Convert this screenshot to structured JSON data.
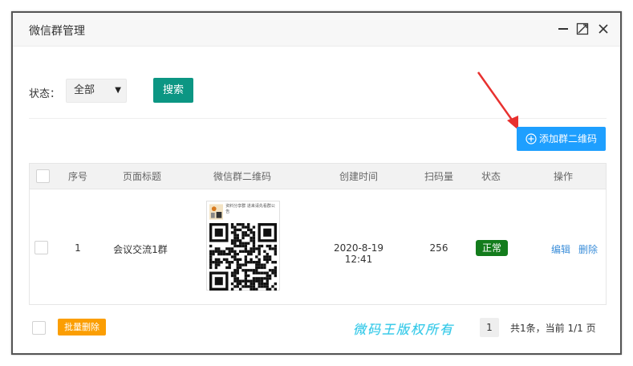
{
  "window": {
    "title": "微信群管理",
    "controls": [
      "minimize-icon",
      "maximize-icon",
      "close-icon"
    ]
  },
  "filter": {
    "status_label": "状态：",
    "status_value": "全部",
    "search_label": "搜索"
  },
  "toolbar": {
    "add_label": "添加群二维码",
    "add_icon": "plus-circle-icon"
  },
  "table": {
    "headers": [
      "序号",
      "页面标题",
      "微信群二维码",
      "创建时间",
      "扫码量",
      "状态",
      "操作"
    ],
    "rows": [
      {
        "index": "1",
        "title": "会议交流1群",
        "qr_caption": "资料分享群 进来请先看群公告",
        "created": "2020-8-19 12:41",
        "scans": "256",
        "status": "正常",
        "edit_label": "编辑",
        "delete_label": "删除"
      }
    ]
  },
  "footer": {
    "batch_delete_label": "批量删除",
    "watermark": "微码王版权所有",
    "page_current": "1",
    "page_info": "共1条，当前 1/1 页"
  },
  "colors": {
    "search_button": "#0c9683",
    "add_button": "#1e9fff",
    "status_badge": "#137c1c",
    "batch_button": "#fb9e03",
    "link": "#3b8ed9",
    "arrow": "#e8312f",
    "watermark": "#33c8e8"
  }
}
